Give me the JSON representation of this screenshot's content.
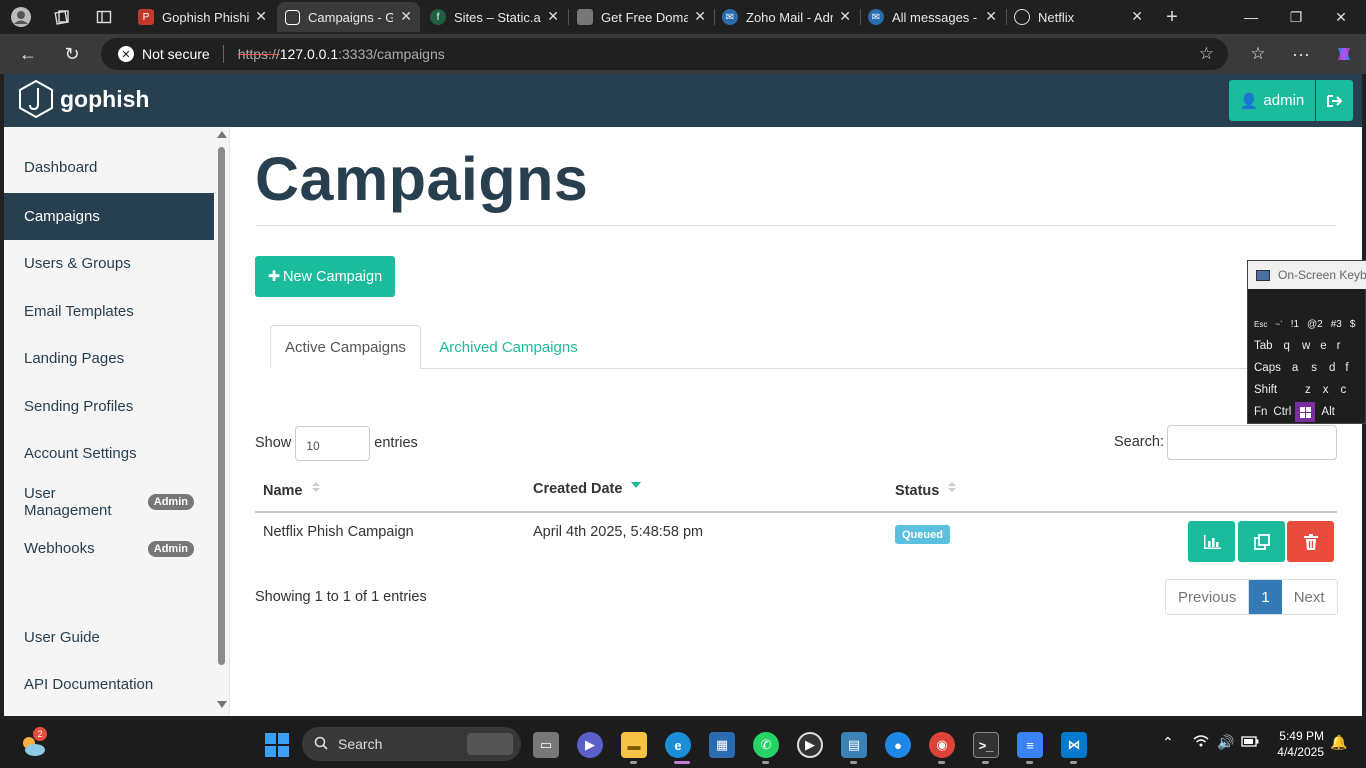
{
  "browser": {
    "tabs": [
      {
        "title": "Gophish Phishing"
      },
      {
        "title": "Campaigns - Gophish"
      },
      {
        "title": "Sites – Static.app"
      },
      {
        "title": "Get Free Domain"
      },
      {
        "title": "Zoho Mail - Admin"
      },
      {
        "title": "All messages - Zoho"
      },
      {
        "title": "Netflix"
      }
    ],
    "security_label": "Not secure",
    "url_scheme": "https://",
    "url_host": "127.0.0.1",
    "url_path": ":3333/campaigns"
  },
  "app": {
    "brand": "gophish",
    "user_label": "admin"
  },
  "sidebar": {
    "items": [
      {
        "label": "Dashboard"
      },
      {
        "label": "Campaigns"
      },
      {
        "label": "Users & Groups"
      },
      {
        "label": "Email Templates"
      },
      {
        "label": "Landing Pages"
      },
      {
        "label": "Sending Profiles"
      },
      {
        "label": "Account Settings"
      },
      {
        "label": "User Management",
        "badge": "Admin"
      },
      {
        "label": "Webhooks",
        "badge": "Admin"
      },
      {
        "label": "User Guide"
      },
      {
        "label": "API Documentation"
      }
    ]
  },
  "main": {
    "title": "Campaigns",
    "new_button": "New Campaign",
    "tabs": [
      {
        "label": "Active Campaigns"
      },
      {
        "label": "Archived Campaigns"
      }
    ],
    "show_label": "Show",
    "entries_value": "10",
    "entries_label": "entries",
    "search_label": "Search:",
    "columns": [
      "Name",
      "Created Date",
      "Status"
    ],
    "rows": [
      {
        "name": "Netflix Phish Campaign",
        "created": "April 4th 2025, 5:48:58 pm",
        "status": "Queued"
      }
    ],
    "showing": "Showing 1 to 1 of 1 entries",
    "pagination": {
      "previous": "Previous",
      "current": "1",
      "next": "Next"
    }
  },
  "osk": {
    "title": "On-Screen Keyboard",
    "row1": [
      "Esc",
      "~`",
      "!1",
      "@2",
      "#3",
      "$"
    ],
    "row2": [
      "Tab",
      "q",
      "w",
      "e",
      "r"
    ],
    "row3": [
      "Caps",
      "a",
      "s",
      "d",
      "f"
    ],
    "row4": [
      "Shift",
      "z",
      "x",
      "c"
    ],
    "row5": [
      "Fn",
      "Ctrl",
      "Alt"
    ]
  },
  "taskbar": {
    "search_placeholder": "Search",
    "time": "5:49 PM",
    "date": "4/4/2025",
    "weather_badge": "2"
  },
  "colors": {
    "brand_dark": "#283f50",
    "accent": "#1abc9c",
    "danger": "#e74c3c",
    "info": "#5bc0de",
    "page_active": "#337ab7"
  }
}
